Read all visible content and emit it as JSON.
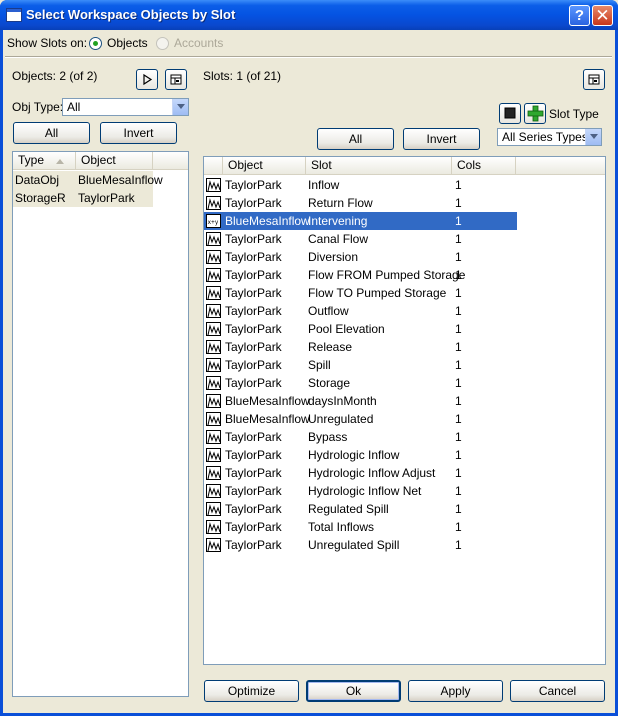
{
  "window": {
    "title": "Select Workspace Objects by Slot"
  },
  "show_slots": {
    "label": "Show Slots on:",
    "objects_label": "Objects",
    "accounts_label": "Accounts"
  },
  "objects_panel": {
    "count_label": "Objects: 2 (of 2)",
    "obj_type_label": "Obj Type:",
    "obj_type_value": "All",
    "all_button": "All",
    "invert_button": "Invert",
    "columns": [
      "Type",
      "Object"
    ],
    "rows": [
      {
        "type": "DataObj",
        "object": "BlueMesaInflow"
      },
      {
        "type": "StorageR",
        "object": "TaylorPark"
      }
    ]
  },
  "slots_panel": {
    "count_label": "Slots: 1 (of 21)",
    "slot_type_label": "Slot Type",
    "series_type_value": "All Series Types",
    "all_button": "All",
    "invert_button": "Invert",
    "columns": [
      "Object",
      "Slot",
      "Cols"
    ],
    "rows": [
      {
        "object": "TaylorPark",
        "slot": "Inflow",
        "cols": "1",
        "icon": "series-slot-icon"
      },
      {
        "object": "TaylorPark",
        "slot": "Return Flow",
        "cols": "1",
        "icon": "series-slot-icon"
      },
      {
        "object": "BlueMesaInflow",
        "slot": "Intervening",
        "cols": "1",
        "icon": "expression-slot-icon",
        "selected": true
      },
      {
        "object": "TaylorPark",
        "slot": "Canal Flow",
        "cols": "1",
        "icon": "series-slot-icon"
      },
      {
        "object": "TaylorPark",
        "slot": "Diversion",
        "cols": "1",
        "icon": "series-slot-icon"
      },
      {
        "object": "TaylorPark",
        "slot": "Flow FROM Pumped Storage",
        "cols": "1",
        "icon": "series-slot-icon"
      },
      {
        "object": "TaylorPark",
        "slot": "Flow TO Pumped Storage",
        "cols": "1",
        "icon": "series-slot-icon"
      },
      {
        "object": "TaylorPark",
        "slot": "Outflow",
        "cols": "1",
        "icon": "series-slot-icon"
      },
      {
        "object": "TaylorPark",
        "slot": "Pool Elevation",
        "cols": "1",
        "icon": "series-slot-icon"
      },
      {
        "object": "TaylorPark",
        "slot": "Release",
        "cols": "1",
        "icon": "series-slot-icon"
      },
      {
        "object": "TaylorPark",
        "slot": "Spill",
        "cols": "1",
        "icon": "series-slot-icon"
      },
      {
        "object": "TaylorPark",
        "slot": "Storage",
        "cols": "1",
        "icon": "series-slot-icon"
      },
      {
        "object": "BlueMesaInflow",
        "slot": "daysInMonth",
        "cols": "1",
        "icon": "series-slot-icon"
      },
      {
        "object": "BlueMesaInflow",
        "slot": "Unregulated",
        "cols": "1",
        "icon": "series-slot-icon"
      },
      {
        "object": "TaylorPark",
        "slot": "Bypass",
        "cols": "1",
        "icon": "series-slot-icon"
      },
      {
        "object": "TaylorPark",
        "slot": "Hydrologic Inflow",
        "cols": "1",
        "icon": "series-slot-icon"
      },
      {
        "object": "TaylorPark",
        "slot": "Hydrologic Inflow Adjust",
        "cols": "1",
        "icon": "series-slot-icon"
      },
      {
        "object": "TaylorPark",
        "slot": "Hydrologic Inflow Net",
        "cols": "1",
        "icon": "series-slot-icon"
      },
      {
        "object": "TaylorPark",
        "slot": "Regulated Spill",
        "cols": "1",
        "icon": "series-slot-icon"
      },
      {
        "object": "TaylorPark",
        "slot": "Total Inflows",
        "cols": "1",
        "icon": "series-slot-icon"
      },
      {
        "object": "TaylorPark",
        "slot": "Unregulated Spill",
        "cols": "1",
        "icon": "series-slot-icon"
      }
    ]
  },
  "footer": {
    "optimize": "Optimize",
    "ok": "Ok",
    "apply": "Apply",
    "cancel": "Cancel"
  },
  "colors": {
    "title_bar": "#0553e2",
    "selection": "#316ac5",
    "face": "#ece9d8"
  }
}
